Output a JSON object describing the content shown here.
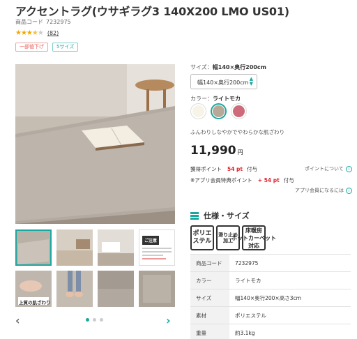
{
  "product": {
    "title": "アクセントラグ(ウサギラグ3 140X200 LMO US01)",
    "code_label": "商品コード",
    "code": "7232975",
    "rating": 3.5,
    "review_count": "(82)"
  },
  "tags": [
    "一部値下げ",
    "5サイズ"
  ],
  "gallery": {
    "thumb_notice_title": "ご注意",
    "thumb_caption": "上質の肌ざわり"
  },
  "size": {
    "label": "サイズ：",
    "value": "幅140×奥行200cm",
    "select_value": "幅140×奥行200cm"
  },
  "color": {
    "label": "カラー：",
    "value": "ライトモカ",
    "swatches": [
      {
        "name": "アイボリー",
        "hex": "#f7f3e6"
      },
      {
        "name": "ライトモカ",
        "hex": "#b8a898"
      },
      {
        "name": "ピンク",
        "hex": "#cd6b7a"
      }
    ]
  },
  "description": "ふんわりしなやかでやわらかな肌ざわり",
  "price": {
    "amount": "11,990",
    "unit": "円"
  },
  "points": {
    "earn_label": "獲得ポイント",
    "earn_value": "54 pt",
    "earn_suffix": "付与",
    "about_link": "ポイントについて",
    "app_label": "※アプリ会員特典ポイント",
    "app_value": "+ 54 pt",
    "app_suffix": "付与",
    "app_link": "アプリ会員になるには"
  },
  "spec": {
    "heading": "仕様・サイズ",
    "badges": [
      "ポリエ\nステル",
      "床暖房\nホットカーペット\n対応",
      "滑り止め\n加工"
    ],
    "rows": [
      {
        "key": "商品コード",
        "value": "7232975"
      },
      {
        "key": "カラー",
        "value": "ライトモカ"
      },
      {
        "key": "サイズ",
        "value": "幅140×奥行200×高さ3cm"
      },
      {
        "key": "素材",
        "value": "ポリエステル"
      },
      {
        "key": "重量",
        "value": "約3.1kg"
      }
    ]
  },
  "colors": {
    "accent": "#1ba7a0",
    "price_red": "#e4242e",
    "star": "#f2a900"
  }
}
